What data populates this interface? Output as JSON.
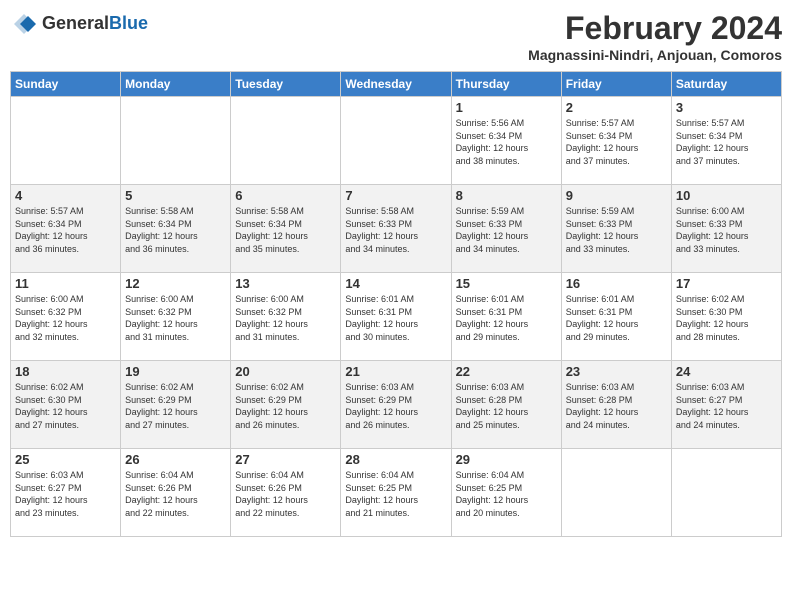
{
  "header": {
    "logo_general": "General",
    "logo_blue": "Blue",
    "month_year": "February 2024",
    "location": "Magnassini-Nindri, Anjouan, Comoros"
  },
  "days_of_week": [
    "Sunday",
    "Monday",
    "Tuesday",
    "Wednesday",
    "Thursday",
    "Friday",
    "Saturday"
  ],
  "weeks": [
    [
      {
        "day": "",
        "info": ""
      },
      {
        "day": "",
        "info": ""
      },
      {
        "day": "",
        "info": ""
      },
      {
        "day": "",
        "info": ""
      },
      {
        "day": "1",
        "info": "Sunrise: 5:56 AM\nSunset: 6:34 PM\nDaylight: 12 hours\nand 38 minutes."
      },
      {
        "day": "2",
        "info": "Sunrise: 5:57 AM\nSunset: 6:34 PM\nDaylight: 12 hours\nand 37 minutes."
      },
      {
        "day": "3",
        "info": "Sunrise: 5:57 AM\nSunset: 6:34 PM\nDaylight: 12 hours\nand 37 minutes."
      }
    ],
    [
      {
        "day": "4",
        "info": "Sunrise: 5:57 AM\nSunset: 6:34 PM\nDaylight: 12 hours\nand 36 minutes."
      },
      {
        "day": "5",
        "info": "Sunrise: 5:58 AM\nSunset: 6:34 PM\nDaylight: 12 hours\nand 36 minutes."
      },
      {
        "day": "6",
        "info": "Sunrise: 5:58 AM\nSunset: 6:34 PM\nDaylight: 12 hours\nand 35 minutes."
      },
      {
        "day": "7",
        "info": "Sunrise: 5:58 AM\nSunset: 6:33 PM\nDaylight: 12 hours\nand 34 minutes."
      },
      {
        "day": "8",
        "info": "Sunrise: 5:59 AM\nSunset: 6:33 PM\nDaylight: 12 hours\nand 34 minutes."
      },
      {
        "day": "9",
        "info": "Sunrise: 5:59 AM\nSunset: 6:33 PM\nDaylight: 12 hours\nand 33 minutes."
      },
      {
        "day": "10",
        "info": "Sunrise: 6:00 AM\nSunset: 6:33 PM\nDaylight: 12 hours\nand 33 minutes."
      }
    ],
    [
      {
        "day": "11",
        "info": "Sunrise: 6:00 AM\nSunset: 6:32 PM\nDaylight: 12 hours\nand 32 minutes."
      },
      {
        "day": "12",
        "info": "Sunrise: 6:00 AM\nSunset: 6:32 PM\nDaylight: 12 hours\nand 31 minutes."
      },
      {
        "day": "13",
        "info": "Sunrise: 6:00 AM\nSunset: 6:32 PM\nDaylight: 12 hours\nand 31 minutes."
      },
      {
        "day": "14",
        "info": "Sunrise: 6:01 AM\nSunset: 6:31 PM\nDaylight: 12 hours\nand 30 minutes."
      },
      {
        "day": "15",
        "info": "Sunrise: 6:01 AM\nSunset: 6:31 PM\nDaylight: 12 hours\nand 29 minutes."
      },
      {
        "day": "16",
        "info": "Sunrise: 6:01 AM\nSunset: 6:31 PM\nDaylight: 12 hours\nand 29 minutes."
      },
      {
        "day": "17",
        "info": "Sunrise: 6:02 AM\nSunset: 6:30 PM\nDaylight: 12 hours\nand 28 minutes."
      }
    ],
    [
      {
        "day": "18",
        "info": "Sunrise: 6:02 AM\nSunset: 6:30 PM\nDaylight: 12 hours\nand 27 minutes."
      },
      {
        "day": "19",
        "info": "Sunrise: 6:02 AM\nSunset: 6:29 PM\nDaylight: 12 hours\nand 27 minutes."
      },
      {
        "day": "20",
        "info": "Sunrise: 6:02 AM\nSunset: 6:29 PM\nDaylight: 12 hours\nand 26 minutes."
      },
      {
        "day": "21",
        "info": "Sunrise: 6:03 AM\nSunset: 6:29 PM\nDaylight: 12 hours\nand 26 minutes."
      },
      {
        "day": "22",
        "info": "Sunrise: 6:03 AM\nSunset: 6:28 PM\nDaylight: 12 hours\nand 25 minutes."
      },
      {
        "day": "23",
        "info": "Sunrise: 6:03 AM\nSunset: 6:28 PM\nDaylight: 12 hours\nand 24 minutes."
      },
      {
        "day": "24",
        "info": "Sunrise: 6:03 AM\nSunset: 6:27 PM\nDaylight: 12 hours\nand 24 minutes."
      }
    ],
    [
      {
        "day": "25",
        "info": "Sunrise: 6:03 AM\nSunset: 6:27 PM\nDaylight: 12 hours\nand 23 minutes."
      },
      {
        "day": "26",
        "info": "Sunrise: 6:04 AM\nSunset: 6:26 PM\nDaylight: 12 hours\nand 22 minutes."
      },
      {
        "day": "27",
        "info": "Sunrise: 6:04 AM\nSunset: 6:26 PM\nDaylight: 12 hours\nand 22 minutes."
      },
      {
        "day": "28",
        "info": "Sunrise: 6:04 AM\nSunset: 6:25 PM\nDaylight: 12 hours\nand 21 minutes."
      },
      {
        "day": "29",
        "info": "Sunrise: 6:04 AM\nSunset: 6:25 PM\nDaylight: 12 hours\nand 20 minutes."
      },
      {
        "day": "",
        "info": ""
      },
      {
        "day": "",
        "info": ""
      }
    ]
  ]
}
